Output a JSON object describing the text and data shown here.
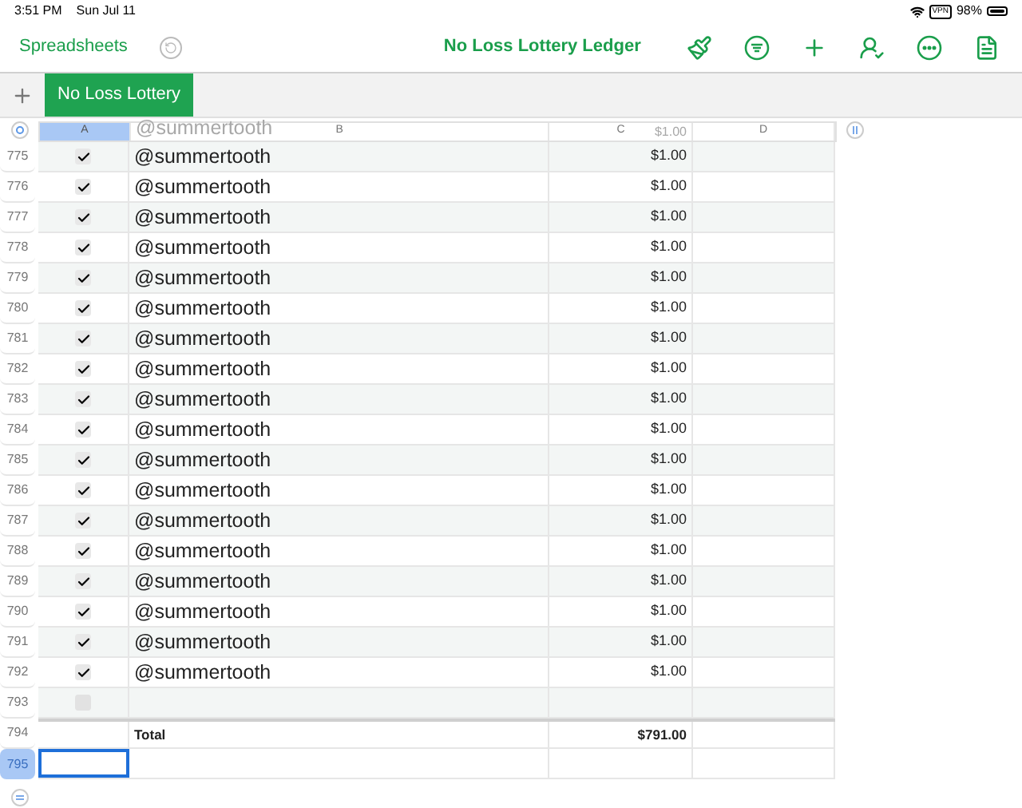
{
  "status_bar": {
    "time": "3:51 PM",
    "date": "Sun Jul 11",
    "vpn": "VPN",
    "battery": "98%"
  },
  "toolbar": {
    "back": "Spreadsheets",
    "title": "No Loss Lottery Ledger"
  },
  "sheet_tabs": [
    {
      "label": "No Loss Lottery",
      "selected": true
    }
  ],
  "table": {
    "columns": [
      {
        "label": "A",
        "selected": true
      },
      {
        "label": "B",
        "selected": false
      },
      {
        "label": "C",
        "selected": false
      },
      {
        "label": "D",
        "selected": false
      }
    ],
    "ghost_row": {
      "name": "@summertooth",
      "amount": "$1.00"
    },
    "rows": [
      {
        "number": "775",
        "kind": "entry",
        "checked": true,
        "name": "@summertooth",
        "amount": "$1.00",
        "selected": false
      },
      {
        "number": "776",
        "kind": "entry",
        "checked": true,
        "name": "@summertooth",
        "amount": "$1.00",
        "selected": false
      },
      {
        "number": "777",
        "kind": "entry",
        "checked": true,
        "name": "@summertooth",
        "amount": "$1.00",
        "selected": false
      },
      {
        "number": "778",
        "kind": "entry",
        "checked": true,
        "name": "@summertooth",
        "amount": "$1.00",
        "selected": false
      },
      {
        "number": "779",
        "kind": "entry",
        "checked": true,
        "name": "@summertooth",
        "amount": "$1.00",
        "selected": false
      },
      {
        "number": "780",
        "kind": "entry",
        "checked": true,
        "name": "@summertooth",
        "amount": "$1.00",
        "selected": false
      },
      {
        "number": "781",
        "kind": "entry",
        "checked": true,
        "name": "@summertooth",
        "amount": "$1.00",
        "selected": false
      },
      {
        "number": "782",
        "kind": "entry",
        "checked": true,
        "name": "@summertooth",
        "amount": "$1.00",
        "selected": false
      },
      {
        "number": "783",
        "kind": "entry",
        "checked": true,
        "name": "@summertooth",
        "amount": "$1.00",
        "selected": false
      },
      {
        "number": "784",
        "kind": "entry",
        "checked": true,
        "name": "@summertooth",
        "amount": "$1.00",
        "selected": false
      },
      {
        "number": "785",
        "kind": "entry",
        "checked": true,
        "name": "@summertooth",
        "amount": "$1.00",
        "selected": false
      },
      {
        "number": "786",
        "kind": "entry",
        "checked": true,
        "name": "@summertooth",
        "amount": "$1.00",
        "selected": false
      },
      {
        "number": "787",
        "kind": "entry",
        "checked": true,
        "name": "@summertooth",
        "amount": "$1.00",
        "selected": false
      },
      {
        "number": "788",
        "kind": "entry",
        "checked": true,
        "name": "@summertooth",
        "amount": "$1.00",
        "selected": false
      },
      {
        "number": "789",
        "kind": "entry",
        "checked": true,
        "name": "@summertooth",
        "amount": "$1.00",
        "selected": false
      },
      {
        "number": "790",
        "kind": "entry",
        "checked": true,
        "name": "@summertooth",
        "amount": "$1.00",
        "selected": false
      },
      {
        "number": "791",
        "kind": "entry",
        "checked": true,
        "name": "@summertooth",
        "amount": "$1.00",
        "selected": false
      },
      {
        "number": "792",
        "kind": "entry",
        "checked": true,
        "name": "@summertooth",
        "amount": "$1.00",
        "selected": false
      },
      {
        "number": "793",
        "kind": "entry",
        "checked": false,
        "selected": false
      },
      {
        "number": "794",
        "kind": "total",
        "label": "Total",
        "amount": "$791.00",
        "selected": false
      },
      {
        "number": "795",
        "kind": "blank",
        "selected": true
      }
    ]
  }
}
